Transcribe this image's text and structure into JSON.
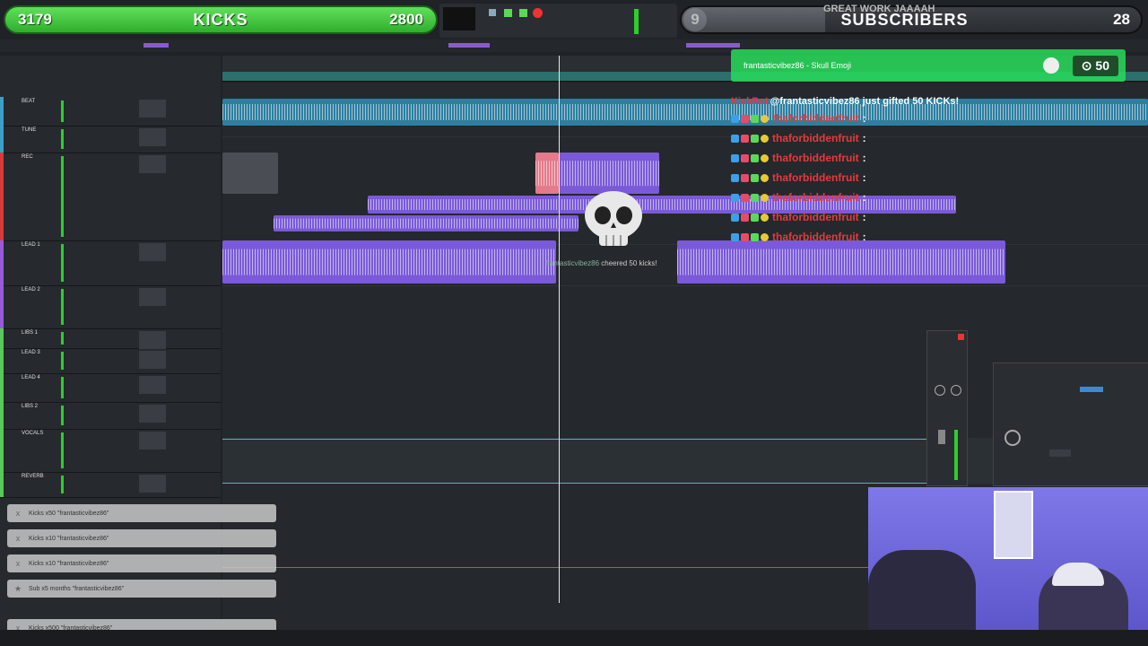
{
  "overlay": {
    "kicks_bar": {
      "current": "3179",
      "label": "KICKS",
      "goal": "2800"
    },
    "subs_bar": {
      "current": "9",
      "label": "SUBSCRIBERS",
      "goal": "28"
    },
    "great_work_text": "GREAT WORK JAAAAH"
  },
  "tip_alert": {
    "text": "frantasticvibez86 - Skull Emoji",
    "amount": "50"
  },
  "chat": {
    "header_user": "KickBot",
    "header_msg": "@frantasticvibez86 just gifted 50 KICKs!",
    "rows": [
      {
        "user": "thaforbiddenfruit",
        "msg": ":"
      },
      {
        "user": "thaforbiddenfruit",
        "msg": ":"
      },
      {
        "user": "thaforbiddenfruit",
        "msg": ":"
      },
      {
        "user": "thaforbiddenfruit",
        "msg": ":"
      },
      {
        "user": "thaforbiddenfruit",
        "msg": ":"
      },
      {
        "user": "thaforbiddenfruit",
        "msg": ":"
      },
      {
        "user": "thaforbiddenfruit",
        "msg": ":"
      }
    ]
  },
  "cheer_text": {
    "user": "frantasticvibez86",
    "action": "cheered",
    "amount": "50",
    "unit": "kicks!"
  },
  "tracks": [
    {
      "name": "BEAT",
      "color": "#3aa0c8"
    },
    {
      "name": "TUNE",
      "color": "#3aa0c8"
    },
    {
      "name": "REC",
      "color": "#d83a3a"
    },
    {
      "name": "LEAD 1",
      "color": "#9a5ad8"
    },
    {
      "name": "LEAD 2",
      "color": "#9a5ad8"
    },
    {
      "name": "LIBS 1",
      "color": "#5ac85a"
    },
    {
      "name": "LEAD 3",
      "color": "#5ac85a"
    },
    {
      "name": "LEAD 4",
      "color": "#5ac85a"
    },
    {
      "name": "LIBS 2",
      "color": "#5ac85a"
    },
    {
      "name": "VOCALS",
      "color": "#5ac85a"
    },
    {
      "name": "REVERB",
      "color": "#5ac85a"
    }
  ],
  "notifications": [
    {
      "icon": "x",
      "text": "Kicks x50 \"frantasticvibez86\""
    },
    {
      "icon": "x",
      "text": "Kicks x10 \"frantasticvibez86\""
    },
    {
      "icon": "x",
      "text": "Kicks x10 \"frantasticvibez86\""
    },
    {
      "icon": "★",
      "text": "Sub x5 months \"frantasticvibez86\""
    },
    {
      "icon": "x",
      "text": "Kicks x500 \"frantasticvibez86\""
    }
  ]
}
